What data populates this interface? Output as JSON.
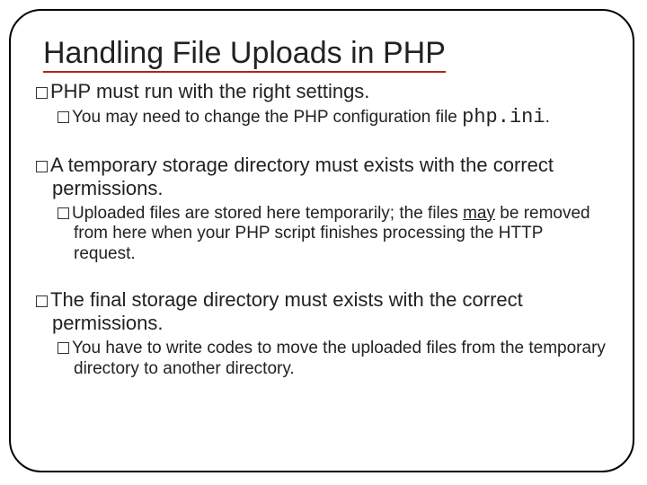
{
  "title": "Handling File Uploads in PHP",
  "b1": "PHP must run with the right settings.",
  "b1a_pre": "You may need to change the PHP configuration file ",
  "b1a_code": "php.ini",
  "b1a_post": ".",
  "b2": "A temporary storage directory must exists with the correct permissions.",
  "b2a_pre": "Uploaded files are stored here temporarily; the files ",
  "b2a_u": "may",
  "b2a_post": " be removed from here when your PHP script finishes processing the HTTP request.",
  "b3": "The final storage directory must exists with the correct permissions.",
  "b3a": "You have to write codes to move the uploaded files from the temporary directory to another directory."
}
